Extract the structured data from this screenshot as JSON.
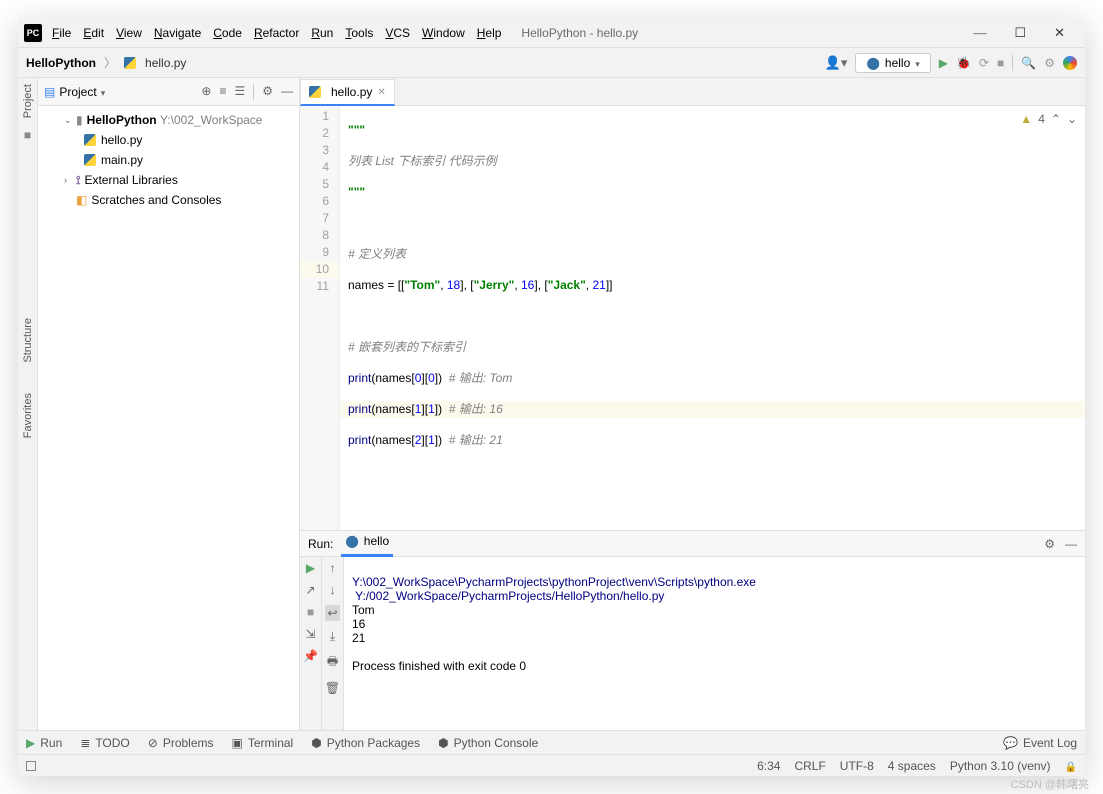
{
  "title_path": "HelloPython - hello.py",
  "menus": [
    "File",
    "Edit",
    "View",
    "Navigate",
    "Code",
    "Refactor",
    "Run",
    "Tools",
    "VCS",
    "Window",
    "Help"
  ],
  "breadcrumb": {
    "project": "HelloPython",
    "file": "hello.py"
  },
  "run_config": {
    "name": "hello"
  },
  "inspection": {
    "warnings": "4"
  },
  "project_panel": {
    "title": "Project",
    "root": {
      "name": "HelloPython",
      "path": "Y:\\002_WorkSpace"
    },
    "files": [
      "hello.py",
      "main.py"
    ],
    "ext_lib": "External Libraries",
    "scratches": "Scratches and Consoles"
  },
  "left_tabs": {
    "project": "Project",
    "structure": "Structure",
    "favorites": "Favorites"
  },
  "editor": {
    "tab": "hello.py",
    "lines": {
      "l1": "\"\"\"",
      "l2": "列表 List 下标索引 代码示例",
      "l3": "\"\"\"",
      "l5": "# 定义列表",
      "l6_pre": "names = [[",
      "l6_s1": "\"Tom\"",
      "l6_n1": "18",
      "l6_s2": "\"Jerry\"",
      "l6_n2": "16",
      "l6_s3": "\"Jack\"",
      "l6_n3": "21",
      "l8": "# 嵌套列表的下标索引",
      "l9_fn": "print",
      "l9_body": "(names[",
      "l9_a": "0",
      "l9_b": "0",
      "l9_c": "# 输出: Tom",
      "l10_fn": "print",
      "l10_body": "(names[",
      "l10_a": "1",
      "l10_b": "1",
      "l10_c": "# 输出: 16",
      "l11_fn": "print",
      "l11_body": "(names[",
      "l11_a": "2",
      "l11_b": "1",
      "l11_c": "# 输出: 21"
    }
  },
  "run": {
    "label": "Run:",
    "tab": "hello",
    "output": {
      "cmd1": "Y:\\002_WorkSpace\\PycharmProjects\\pythonProject\\venv\\Scripts\\python.exe",
      "cmd2": " Y:/002_WorkSpace/PycharmProjects/HelloPython/hello.py",
      "o1": "Tom",
      "o2": "16",
      "o3": "21",
      "exit": "Process finished with exit code 0"
    }
  },
  "bottom": {
    "run": "Run",
    "todo": "TODO",
    "problems": "Problems",
    "terminal": "Terminal",
    "pkgs": "Python Packages",
    "console": "Python Console",
    "eventlog": "Event Log"
  },
  "status": {
    "pos": "6:34",
    "eol": "CRLF",
    "enc": "UTF-8",
    "indent": "4 spaces",
    "interp": "Python 3.10 (venv)"
  },
  "watermark": "CSDN @韩曙亮"
}
